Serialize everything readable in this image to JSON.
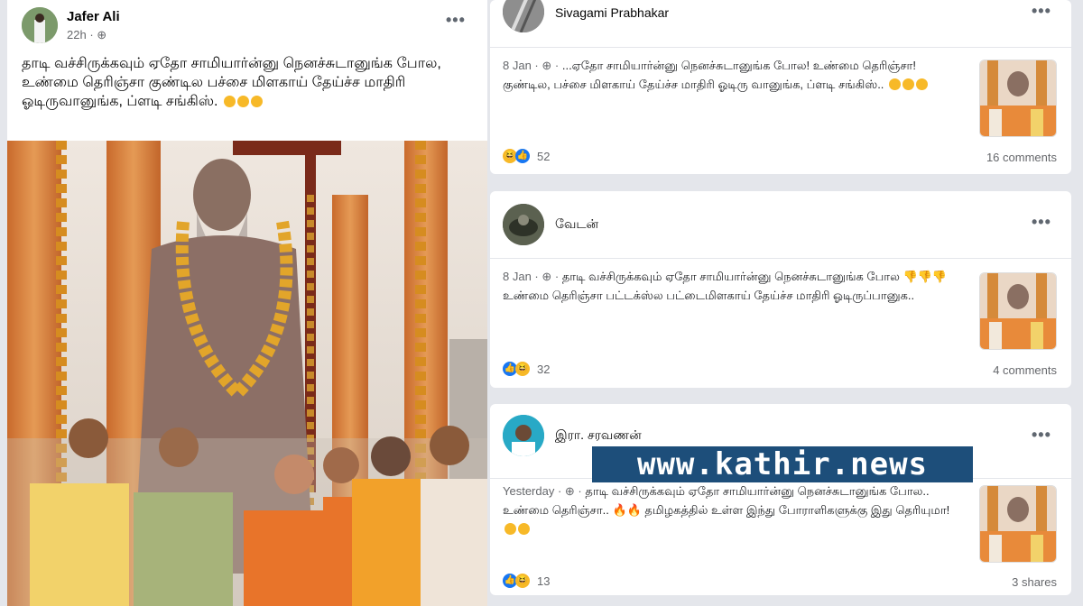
{
  "left_post": {
    "author": "Jafer Ali",
    "time": "22h",
    "text": "தாடி வச்சிருக்கவும் ஏதோ சாமியார்ன்னு நெனச்சுடானுங்க போல, உண்மை தெரிஞ்சா குண்டில பச்சை மிளகாய் தேய்ச்ச மாதிரி ஓடிருவானுங்க, ப்ளடி சங்கிஸ்.",
    "menu_icon": "more-horizontal-icon"
  },
  "right_posts": [
    {
      "author": "Sivagami Prabhakar",
      "time": "8 Jan",
      "text": "...ஏதோ சாமியார்ன்னு நெனச்சுடானுங்க போல! உண்மை தெரிஞ்சா! குண்டில, பச்சை மிளகாய் தேய்ச்ச மாதிரி ஓடிரு வானுங்க, ப்ளடி சங்கிஸ்..",
      "reactions": "52",
      "count_label": "16 comments"
    },
    {
      "author": "வேடன்",
      "time": "8 Jan",
      "text": "தாடி வச்சிருக்கவும் ஏதோ சாமியார்ன்னு நெனச்சுடானுங்க போல 👎👎👎 உண்மை தெரிஞ்சா பட்டக்ஸ்ல பட்டைமிளகாய் தேய்ச்ச மாதிரி ஓடிருப்பானுக..",
      "reactions": "32",
      "count_label": "4 comments"
    },
    {
      "author": "இரா. சரவணன்",
      "time": "Yesterday",
      "text": "தாடி வச்சிருக்கவும் ஏதோ சாமியார்ன்னு நெனச்சுடானுங்க போல.. உண்மை தெரிஞ்சா.. 🔥🔥 தமிழகத்தில் உள்ள இந்து போராளிகளுக்கு இது தெரியுமா!",
      "reactions": "13",
      "count_label": "3 shares"
    }
  ],
  "watermark": "www.kathir.news",
  "colors": {
    "accent": "#1877f2",
    "watermark_bg": "#1d4e7a",
    "haha": "#f7b928"
  }
}
